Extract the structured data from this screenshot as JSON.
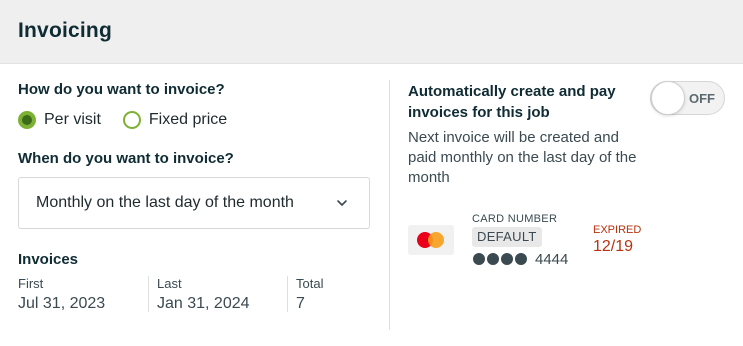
{
  "header": {
    "title": "Invoicing"
  },
  "method": {
    "question": "How do you want to invoice?",
    "options": [
      {
        "label": "Per visit",
        "selected": true
      },
      {
        "label": "Fixed price",
        "selected": false
      }
    ]
  },
  "timing": {
    "question": "When do you want to invoice?",
    "selected": "Monthly on the last day of the month"
  },
  "invoices": {
    "title": "Invoices",
    "first_label": "First",
    "first_value": "Jul 31, 2023",
    "last_label": "Last",
    "last_value": "Jan 31, 2024",
    "total_label": "Total",
    "total_value": "7"
  },
  "auto": {
    "title": "Automatically create and pay invoices for this job",
    "toggle_label": "OFF",
    "description": "Next invoice will be created and paid monthly on the last day of the month"
  },
  "card": {
    "number_label": "CARD NUMBER",
    "badge": "DEFAULT",
    "last4": "4444",
    "expired_label": "EXPIRED",
    "expiry": "12/19"
  },
  "colors": {
    "accent_green": "#7db135",
    "expired_red": "#b8320f",
    "heading": "#0f2b33"
  }
}
